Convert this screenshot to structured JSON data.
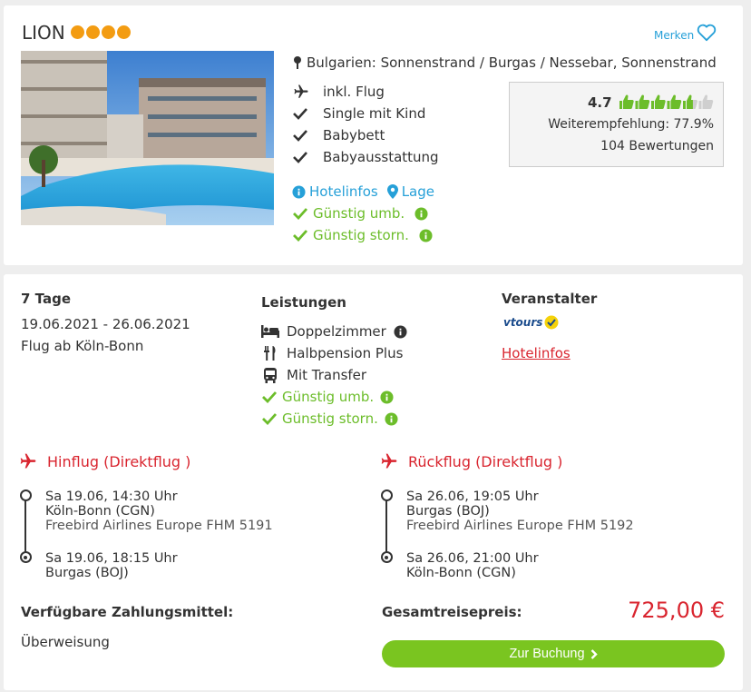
{
  "hotel": {
    "name": "LION",
    "stars": 4,
    "merken_label": "Merken",
    "location": "Bulgarien: Sonnenstrand / Burgas / Nessebar, Sonnenstrand",
    "features": [
      {
        "icon": "plane-icon",
        "label": "inkl. Flug"
      },
      {
        "icon": "check-icon",
        "label": "Single mit Kind"
      },
      {
        "icon": "check-icon",
        "label": "Babybett"
      },
      {
        "icon": "check-icon",
        "label": "Babyausstattung"
      }
    ],
    "links": {
      "hotelinfos": "Hotelinfos",
      "lage": "Lage"
    },
    "guenstig_umb": "Günstig umb.",
    "guenstig_storn": "Günstig storn."
  },
  "rating": {
    "score": "4.7",
    "thumbs_filled": 4.7,
    "recommendation": "Weiterempfehlung: 77.9%",
    "reviews": "104 Bewertungen"
  },
  "offer": {
    "duration": "7 Tage",
    "dates": "19.06.2021 - 26.06.2021",
    "departure": "Flug ab Köln-Bonn",
    "services_title": "Leistungen",
    "services": [
      {
        "icon": "bed-icon",
        "label": "Doppelzimmer"
      },
      {
        "icon": "cutlery-icon",
        "label": "Halbpension Plus"
      },
      {
        "icon": "bus-icon",
        "label": "Mit Transfer"
      }
    ],
    "guenstig_umb": "Günstig umb.",
    "guenstig_storn": "Günstig storn.",
    "operator_title": "Veranstalter",
    "operator_logo_text": "vtours",
    "operator_link": "Hotelinfos"
  },
  "outbound": {
    "title": "Hinflug (Direktflug )",
    "dep_time": "Sa 19.06, 14:30 Uhr",
    "dep_airport": "Köln-Bonn (CGN)",
    "airline": "Freebird Airlines Europe FHM 5191",
    "arr_time": "Sa 19.06, 18:15 Uhr",
    "arr_airport": "Burgas (BOJ)"
  },
  "return": {
    "title": "Rückflug (Direktflug )",
    "dep_time": "Sa 26.06, 19:05 Uhr",
    "dep_airport": "Burgas (BOJ)",
    "airline": "Freebird Airlines Europe FHM 5192",
    "arr_time": "Sa 26.06, 21:00 Uhr",
    "arr_airport": "Köln-Bonn (CGN)"
  },
  "payment": {
    "title": "Verfügbare Zahlungsmittel:",
    "method": "Überweisung"
  },
  "total": {
    "label": "Gesamtreisepreis:",
    "price": "725,00 €",
    "button": "Zur Buchung"
  },
  "colors": {
    "accent_red": "#d9252f",
    "accent_green": "#7ac520",
    "link_blue": "#26a0d8",
    "star_orange": "#f39c12"
  }
}
